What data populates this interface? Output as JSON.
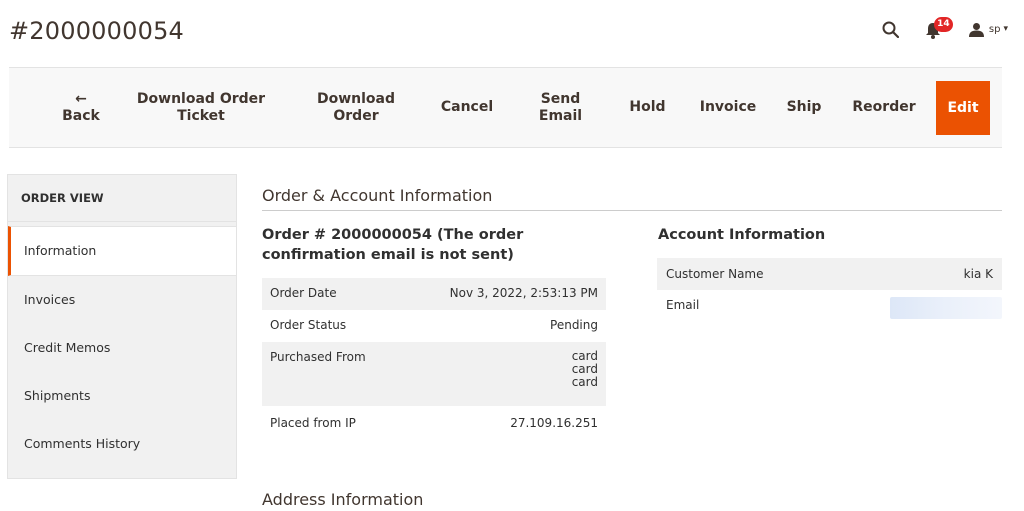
{
  "page": {
    "title": "#2000000054"
  },
  "header": {
    "search_icon": "search-icon",
    "notifications_count": "14",
    "user_name": "sp",
    "caret": "▾"
  },
  "toolbar": {
    "back_arrow": "←",
    "back": "Back",
    "download_ticket_line1": "Download Order",
    "download_ticket_line2": "Ticket",
    "download_order_line1": "Download",
    "download_order_line2": "Order",
    "cancel": "Cancel",
    "send_email_line1": "Send",
    "send_email_line2": "Email",
    "hold": "Hold",
    "invoice": "Invoice",
    "ship": "Ship",
    "reorder": "Reorder",
    "edit": "Edit"
  },
  "sidebar": {
    "heading": "ORDER VIEW",
    "items": [
      "Information",
      "Invoices",
      "Credit Memos",
      "Shipments",
      "Comments History"
    ]
  },
  "main": {
    "section_title": "Order & Account Information",
    "order_title": "Order # 2000000054 (The order confirmation email is not sent)",
    "order_rows": [
      {
        "label": "Order Date",
        "value": "Nov 3, 2022, 2:53:13 PM"
      },
      {
        "label": "Order Status",
        "value": "Pending"
      },
      {
        "label": "Purchased From",
        "value_lines": [
          "card",
          "card",
          "card"
        ]
      },
      {
        "label": "Placed from IP",
        "value": "27.109.16.251"
      }
    ],
    "account_title": "Account Information",
    "account_rows": [
      {
        "label": "Customer Name",
        "value": "kia K"
      },
      {
        "label": "Email",
        "value": ""
      }
    ],
    "address_title": "Address Information"
  },
  "colors": {
    "accent": "#eb5202",
    "badge": "#e22626",
    "row_alt": "#f1f1f1"
  }
}
